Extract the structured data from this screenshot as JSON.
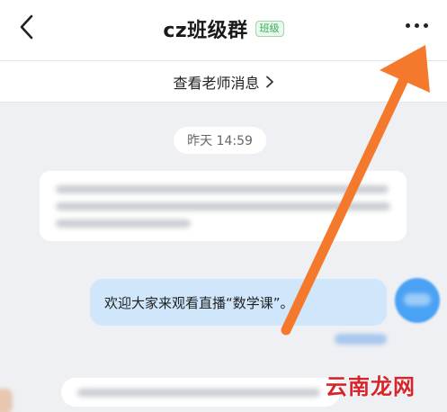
{
  "header": {
    "title": "cz班级群",
    "badge": "班级",
    "back_icon": "chevron-left-icon",
    "more_icon": "more-dots-icon"
  },
  "teacher_bar": {
    "label": "查看老师消息",
    "icon": "chevron-right-icon"
  },
  "chat": {
    "timestamp": "昨天 14:59",
    "sent_message": "欢迎大家来观看直播“数学课”。"
  },
  "overlay": {
    "arrow_color": "#f5792c",
    "watermark": "云南龙网",
    "watermark_color": "#d6262c"
  },
  "colors": {
    "background": "#eef0f3",
    "sent_bubble": "#cfe6fb",
    "badge_green": "#2bb04f",
    "avatar_blue": "#4aa2f5"
  }
}
